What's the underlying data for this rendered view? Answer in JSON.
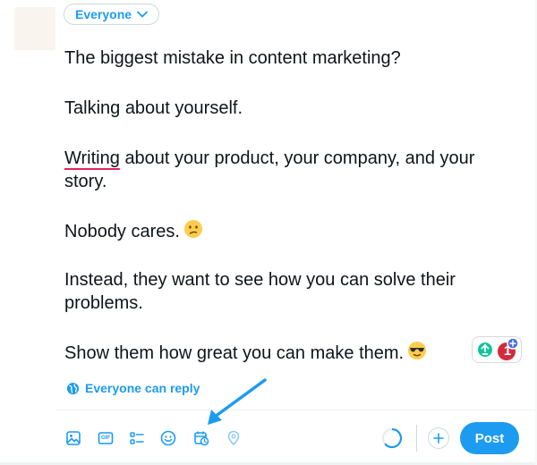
{
  "audience": {
    "label": "Everyone"
  },
  "post": {
    "paragraphs": [
      "The biggest mistake in content marketing?",
      "Talking about yourself.",
      "about your product, your company, and your story.",
      "Nobody cares.",
      "Instead, they want to see how you can solve their problems.",
      "Show them how great you can make them."
    ],
    "misspelled_word": "Writing",
    "emojis": [
      "confused-face",
      "smiling-face-with-sunglasses"
    ]
  },
  "grammar_widget": {
    "count": "1"
  },
  "reply_setting": {
    "label": "Everyone can reply"
  },
  "toolbar": {
    "icons": [
      "image-icon",
      "gif-icon",
      "poll-icon",
      "emoji-icon",
      "schedule-icon",
      "location-icon"
    ],
    "gif_label": "GIF",
    "post_label": "Post"
  },
  "colors": {
    "accent": "#1d9bf0",
    "text": "#0f1419",
    "misspelling": "#e0245e",
    "border": "#cfd9de"
  }
}
